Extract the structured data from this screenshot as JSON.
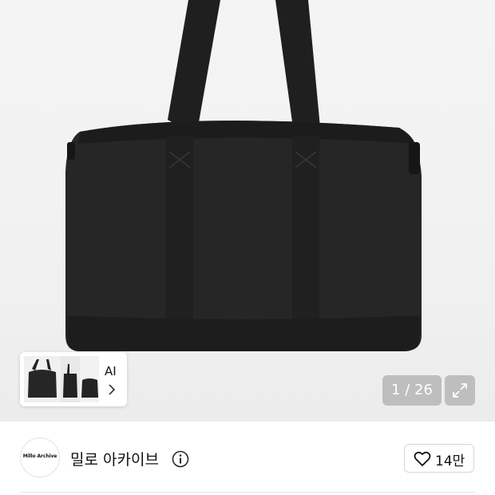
{
  "gallery": {
    "ai_label": "AI",
    "counter": "1 / 26",
    "thumbnail_alt": "bag thumbnails"
  },
  "seller": {
    "avatar_text": "Millo Archive",
    "name": "밀로 아카이브"
  },
  "like": {
    "count": "14만"
  },
  "icons": {
    "expand": "expand-icon",
    "chevron": "chevron-right-icon",
    "info": "info-icon",
    "heart": "heart-icon"
  }
}
